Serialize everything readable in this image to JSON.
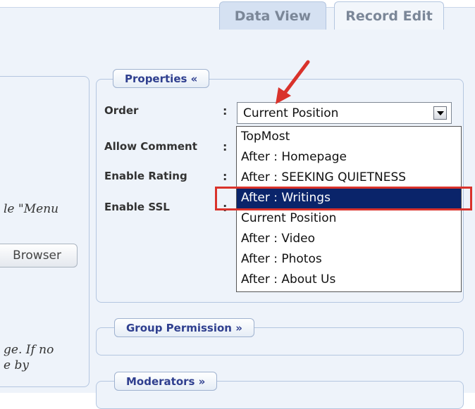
{
  "tabs": {
    "data_view": "Data View",
    "record_edit": "Record Edit"
  },
  "left_panel": {
    "text_menu": "le \"Menu",
    "browser_button": "Browser",
    "text_if_no": "ge. If no",
    "text_e_by": "e by"
  },
  "properties": {
    "legend": "Properties «",
    "labels": {
      "order": "Order",
      "allow_comment": "Allow Comment",
      "enable_rating": "Enable Rating",
      "enable_ssl": "Enable SSL"
    },
    "colon": ":",
    "order_select": {
      "selected": "Current Position",
      "options": [
        "TopMost",
        "After : Homepage",
        "After : SEEKING QUIETNESS",
        "After : Writings",
        "Current Position",
        "After : Video",
        "After : Photos",
        "After : About Us"
      ],
      "highlighted_index": 3
    }
  },
  "group_permission": {
    "legend": "Group Permission »"
  },
  "moderators": {
    "legend": "Moderators »"
  },
  "colors": {
    "highlight": "#0a246a",
    "annotation": "#d9322b",
    "legend_text": "#2f3f8f"
  }
}
